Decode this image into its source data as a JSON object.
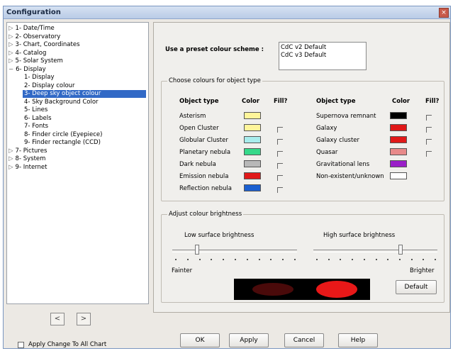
{
  "window": {
    "title": "Configuration",
    "close_glyph": "×"
  },
  "tree": [
    {
      "label": "1- Date/Time",
      "expander": "▷"
    },
    {
      "label": "2- Observatory",
      "expander": "▷"
    },
    {
      "label": "3- Chart, Coordinates",
      "expander": "▷"
    },
    {
      "label": "4- Catalog",
      "expander": "▷"
    },
    {
      "label": "5- Solar System",
      "expander": "▷"
    },
    {
      "label": "6- Display",
      "expander": "−"
    },
    {
      "label": "1- Display",
      "expander": ""
    },
    {
      "label": "2- Display colour",
      "expander": ""
    },
    {
      "label": "3- Deep sky object colour",
      "expander": "",
      "selected": true
    },
    {
      "label": "4- Sky Background Color",
      "expander": ""
    },
    {
      "label": "5- Lines",
      "expander": ""
    },
    {
      "label": "6- Labels",
      "expander": ""
    },
    {
      "label": "7- Fonts",
      "expander": ""
    },
    {
      "label": "8- Finder circle (Eyepiece)",
      "expander": ""
    },
    {
      "label": "9- Finder rectangle (CCD)",
      "expander": ""
    },
    {
      "label": "7- Pictures",
      "expander": "▷"
    },
    {
      "label": "8- System",
      "expander": "▷"
    },
    {
      "label": "9- Internet",
      "expander": "▷"
    }
  ],
  "nav": {
    "prev": "<",
    "next": ">"
  },
  "preset": {
    "label": "Use a preset colour scheme :",
    "options": [
      "CdC v2 Default",
      "CdC v3 Default"
    ]
  },
  "colours_group": {
    "caption": "Choose colours for object type",
    "headers": {
      "object_type": "Object type",
      "color": "Color",
      "fill": "Fill?"
    },
    "left": [
      {
        "name": "Asterism",
        "color": "#fff59a",
        "fill": false
      },
      {
        "name": "Open Cluster",
        "color": "#fff59a",
        "fill": true
      },
      {
        "name": "Globular Cluster",
        "color": "#a8ecec",
        "fill": true
      },
      {
        "name": "Planetary nebula",
        "color": "#36d98a",
        "fill": true
      },
      {
        "name": "Dark nebula",
        "color": "#b8b8b8",
        "fill": true
      },
      {
        "name": "Emission nebula",
        "color": "#e01818",
        "fill": true
      },
      {
        "name": "Reflection nebula",
        "color": "#1a5fd0",
        "fill": true
      }
    ],
    "right": [
      {
        "name": "Supernova remnant",
        "color": "#000000",
        "fill": true
      },
      {
        "name": "Galaxy",
        "color": "#e01818",
        "fill": true
      },
      {
        "name": "Galaxy cluster",
        "color": "#e01818",
        "fill": true
      },
      {
        "name": "Quasar",
        "color": "#e88a8a",
        "fill": true
      },
      {
        "name": "Gravitational lens",
        "color": "#9a1fc8",
        "fill": false
      },
      {
        "name": "Non-existent/unknown",
        "color": "#ffffff",
        "fill": false
      }
    ]
  },
  "brightness_group": {
    "caption": "Adjust colour brightness",
    "low_label": "Low surface brightness",
    "high_label": "High surface brightness",
    "fainter": "Fainter",
    "brighter": "Brighter",
    "low_level": 0.2,
    "high_level": 0.7,
    "default_button": "Default"
  },
  "footer": {
    "apply_all": "Apply Change To All Chart",
    "ok": "OK",
    "apply": "Apply",
    "cancel": "Cancel",
    "help": "Help"
  }
}
